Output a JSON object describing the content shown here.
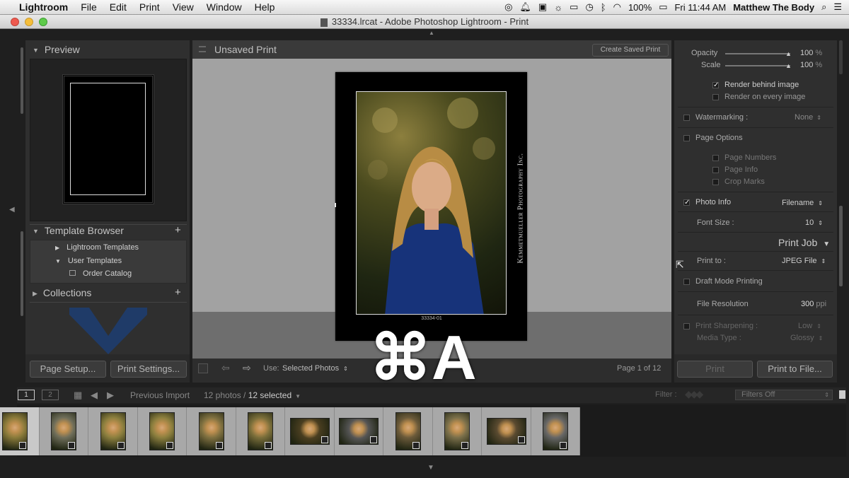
{
  "menubar": {
    "app": "Lightroom",
    "items": [
      "File",
      "Edit",
      "Print",
      "View",
      "Window",
      "Help"
    ],
    "battery": "100%",
    "clock": "Fri 11:44 AM",
    "user": "Matthew The Body"
  },
  "window": {
    "title": "33334.lrcat - Adobe Photoshop Lightroom - Print"
  },
  "left": {
    "preview_title": "Preview",
    "template_browser_title": "Template Browser",
    "templates": [
      "Lightroom Templates",
      "User Templates",
      "Order Catalog"
    ],
    "collections_title": "Collections",
    "page_setup": "Page Setup...",
    "print_settings": "Print Settings..."
  },
  "center": {
    "doc_title": "Unsaved Print",
    "create_saved": "Create Saved Print",
    "watermark": "Kemmetmueller Photography Inc.",
    "filename_caption": "33334-01",
    "overlay": "⌘A",
    "use_label": "Use:",
    "use_value": "Selected Photos",
    "page_counter": "Page 1 of 12"
  },
  "right": {
    "opacity_label": "Opacity",
    "opacity_value": "100",
    "opacity_unit": "%",
    "scale_label": "Scale",
    "scale_value": "100",
    "scale_unit": "%",
    "render_behind": "Render behind image",
    "render_every": "Render on every image",
    "watermarking_label": "Watermarking :",
    "watermarking_value": "None",
    "page_options": "Page Options",
    "page_numbers": "Page Numbers",
    "page_info": "Page Info",
    "crop_marks": "Crop Marks",
    "photo_info": "Photo Info",
    "photo_info_value": "Filename",
    "font_size_label": "Font Size :",
    "font_size_value": "10",
    "print_job_title": "Print Job",
    "print_to_label": "Print to :",
    "print_to_value": "JPEG File",
    "draft_mode": "Draft Mode Printing",
    "file_res_label": "File Resolution",
    "file_res_value": "300",
    "file_res_unit": "ppi",
    "print_sharpening": "Print Sharpening :",
    "sharpening_value": "Low",
    "media_type": "Media Type :",
    "media_value": "Glossy",
    "print_btn": "Print",
    "print_to_file_btn": "Print to File..."
  },
  "filmbar": {
    "page1": "1",
    "page2": "2",
    "source": "Previous Import",
    "count": "12 photos /",
    "selected": "12 selected",
    "filter_label": "Filter :",
    "filter_value": "Filters Off"
  },
  "filmstrip": {
    "count": 12
  }
}
